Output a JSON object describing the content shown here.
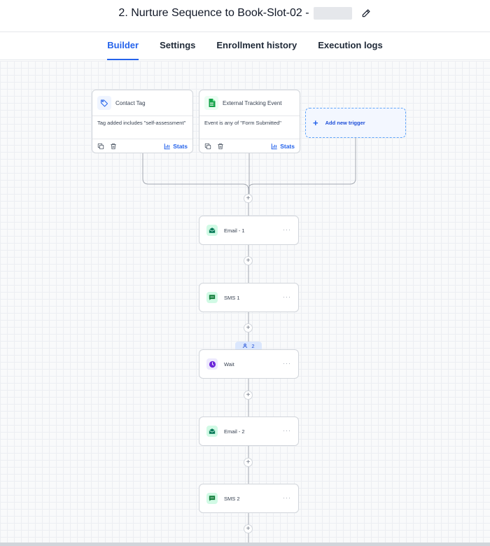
{
  "header": {
    "title": "2. Nurture Sequence to Book-Slot-02 -"
  },
  "tabs": [
    {
      "label": "Builder",
      "active": true
    },
    {
      "label": "Settings",
      "active": false
    },
    {
      "label": "Enrollment history",
      "active": false
    },
    {
      "label": "Execution logs",
      "active": false
    }
  ],
  "triggers": [
    {
      "title": "Contact Tag",
      "condition": "Tag added includes \"self-assessment\"",
      "stats_label": "Stats",
      "icon": "tag-icon"
    },
    {
      "title": "External Tracking Event",
      "condition": "Event is any of \"Form Submitted\"",
      "stats_label": "Stats",
      "icon": "sheet-icon"
    }
  ],
  "add_trigger": {
    "label": "Add new trigger"
  },
  "actions": [
    {
      "label": "Email - 1",
      "icon": "email-icon"
    },
    {
      "label": "SMS 1",
      "icon": "sms-icon"
    },
    {
      "label": "Wait",
      "icon": "clock-icon"
    },
    {
      "label": "Email - 2",
      "icon": "email-icon"
    },
    {
      "label": "SMS 2",
      "icon": "sms-icon"
    }
  ],
  "wait_badge": {
    "count": "2"
  },
  "colors": {
    "accent": "#2563eb",
    "email_bg": "#d1fae5",
    "email_fg": "#047857",
    "sms_bg": "#d1fae5",
    "sms_fg": "#15803d",
    "wait_bg": "#ede9fe",
    "wait_fg": "#6d28d9"
  }
}
